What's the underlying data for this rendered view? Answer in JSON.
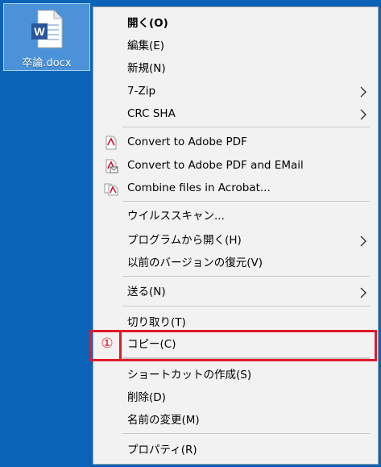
{
  "file": {
    "name": "卒論.docx",
    "icon": "word-document-icon",
    "letter": "W"
  },
  "menu": {
    "items": [
      {
        "label": "開く(O)",
        "bold": true
      },
      {
        "label": "編集(E)"
      },
      {
        "label": "新規(N)"
      },
      {
        "label": "7-Zip",
        "submenu": true
      },
      {
        "label": "CRC SHA",
        "submenu": true
      },
      {
        "label": "Convert to Adobe PDF",
        "icon": "adobe-pdf-icon"
      },
      {
        "label": "Convert to Adobe PDF and EMail",
        "icon": "adobe-pdf-email-icon"
      },
      {
        "label": "Combine files in Acrobat...",
        "icon": "acrobat-combine-icon"
      },
      {
        "label": "ウイルススキャン..."
      },
      {
        "label": "プログラムから開く(H)",
        "submenu": true
      },
      {
        "label": "以前のバージョンの復元(V)"
      },
      {
        "label": "送る(N)",
        "submenu": true
      },
      {
        "label": "切り取り(T)"
      },
      {
        "label": "コピー(C)",
        "highlighted": true
      },
      {
        "label": "ショートカットの作成(S)"
      },
      {
        "label": "削除(D)"
      },
      {
        "label": "名前の変更(M)"
      },
      {
        "label": "プロパティ(R)"
      }
    ]
  },
  "annotation": {
    "marker": "①",
    "color": "#e01a2b"
  },
  "colors": {
    "desktop": "#0b63b8",
    "menu_bg": "#f2f2f2",
    "pdf_red": "#c8102e"
  }
}
